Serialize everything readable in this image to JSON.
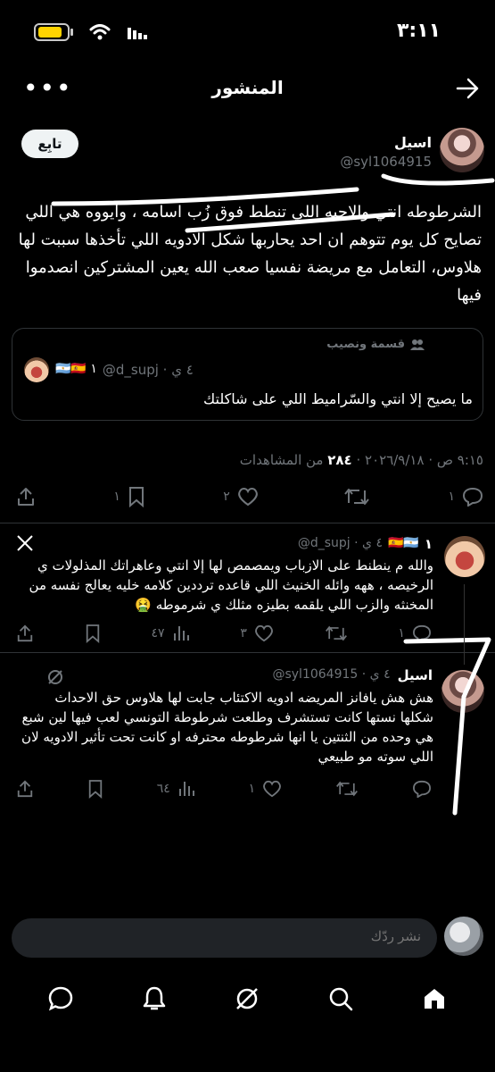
{
  "status_bar": {
    "time": "٣:١١"
  },
  "header": {
    "title": "المنشور"
  },
  "post": {
    "follow_label": "تابِع",
    "author_name": "اسيل",
    "author_handle": "@syl1064915",
    "text": "الشرطوطه انتي والاحبه اللي تنطط فوق زُب اسامه ، وايووه هي اللي تصايح كل يوم تتوهم ان احد يحاربها شكل الادويه اللي تأخذها سببت لها هلاوس،  التعامل مع مريضة نفسيا صعب الله يعين المشتركين انصدموا فيها",
    "quote": {
      "community": "قسمة ونصيب",
      "meta": "@d_supj · ٤ ي",
      "flags": "🇦🇷🇪🇸 ١",
      "text": "ما يصيح إلا انتي والسّراميط اللي على شاكلتك"
    },
    "timestamp": "٩:١٥ ص · ٢٠٢٦/٩/١٨ ·",
    "views_count": "٢٨٤",
    "views_label": "من المشاهدات",
    "stats": {
      "replies": "١",
      "reposts": "",
      "likes": "٢",
      "bookmarks": "١"
    }
  },
  "replies": [
    {
      "name": "١",
      "flags": "🇪🇸🇦🇷",
      "meta": "@d_supj · ٤ ي",
      "text": "والله م ينطنط على الازباب ويمصمص لها إلا انتي وعاهراتك المذلولات ي الرخيصه ، ههه وائله الخنيث اللي قاعده ترددين كلامه خليه يعالج نفسه من المخنثه والزب اللي يلقمه بطيزه مثلك ي شرموطه 🤮",
      "stats": {
        "replies": "١",
        "reposts": "",
        "likes": "٣",
        "views": "٤٧"
      }
    },
    {
      "name": "اسيل",
      "meta": "@syl1064915 · ٤ ي",
      "text": "هش هش يافانز المريضه ادويه الاكتئاب جابت لها هلاوس حق الاحداث شكلها نستها كانت تستشرف وطلعت شرطوطة التونسي لعب فيها لين شبع هي وحده من الثنتين يا انها شرطوطه محترفه او كانت تحت تأثير الادويه لان اللي سوته مو طبيعي",
      "stats": {
        "replies": "",
        "reposts": "",
        "likes": "١",
        "views": "٦٤"
      }
    }
  ],
  "compose": {
    "placeholder": "نشر ردّك"
  },
  "icons": {
    "back": "arrow-right-icon",
    "more": "more-icon",
    "community": "people-icon",
    "reply": "reply-icon",
    "repost": "repost-icon",
    "like": "heart-icon",
    "bookmark": "bookmark-icon",
    "share": "share-icon",
    "views": "views-icon",
    "grok": "grok-icon",
    "x_logo": "x-logo-icon",
    "nav": [
      "home-icon",
      "search-icon",
      "grok-icon",
      "notifications-icon",
      "messages-icon"
    ]
  },
  "colors": {
    "background": "#000000",
    "muted": "#71767b",
    "text": "#e7e9ea",
    "divider": "#2f3336"
  }
}
